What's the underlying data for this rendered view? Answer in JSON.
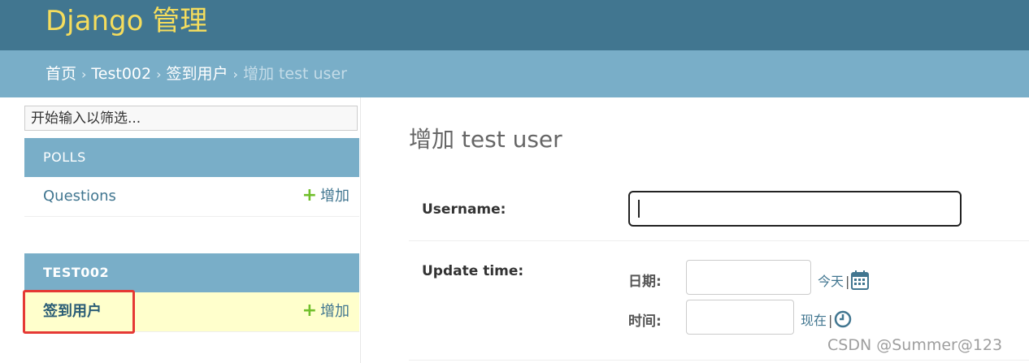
{
  "header": {
    "brand": "Django 管理"
  },
  "breadcrumbs": {
    "items": [
      "首页",
      "Test002",
      "签到用户"
    ],
    "current": "增加 test user",
    "separator": "›"
  },
  "sidebar": {
    "filter_placeholder": "开始输入以筛选...",
    "modules": [
      {
        "name": "POLLS",
        "models": [
          {
            "label": "Questions",
            "add": "增加"
          }
        ]
      },
      {
        "name": "TEST002",
        "models": [
          {
            "label": "签到用户",
            "add": "增加",
            "active": true
          }
        ]
      }
    ]
  },
  "form": {
    "title": "增加 test user",
    "username_label": "Username:",
    "username_value": "",
    "update_time_label": "Update time:",
    "date_label": "日期:",
    "date_shortcut": "今天",
    "time_label": "时间:",
    "time_shortcut": "现在",
    "shortcut_separator": "|"
  },
  "watermark": "CSDN @Summer@123",
  "colors": {
    "header_bg": "#417690",
    "brand": "#f5dd5d",
    "breadcrumb_bg": "#79aec8",
    "module_bg": "#79aec8",
    "link": "#417690",
    "add_plus": "#70bf2b",
    "active_row": "#ffffcc",
    "highlight": "#e53935"
  }
}
